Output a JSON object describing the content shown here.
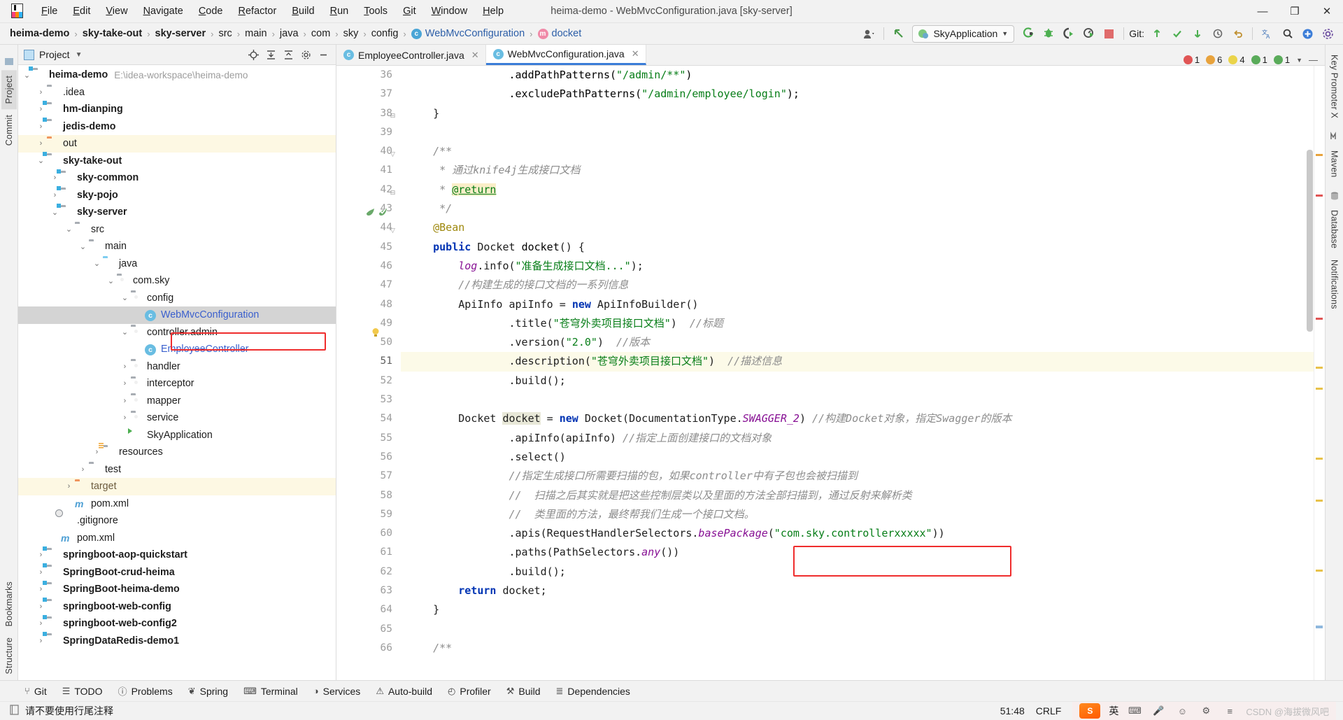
{
  "window": {
    "title": "heima-demo - WebMvcConfiguration.java [sky-server]",
    "minimize": "—",
    "maximize": "❐",
    "close": "✕"
  },
  "menu": [
    {
      "label": "File"
    },
    {
      "label": "Edit"
    },
    {
      "label": "View"
    },
    {
      "label": "Navigate"
    },
    {
      "label": "Code"
    },
    {
      "label": "Refactor"
    },
    {
      "label": "Build"
    },
    {
      "label": "Run"
    },
    {
      "label": "Tools"
    },
    {
      "label": "Git"
    },
    {
      "label": "Window"
    },
    {
      "label": "Help"
    }
  ],
  "breadcrumb": [
    {
      "label": "heima-demo",
      "style": "bold"
    },
    {
      "label": "sky-take-out",
      "style": "bold"
    },
    {
      "label": "sky-server",
      "style": "bold"
    },
    {
      "label": "src",
      "style": "plain"
    },
    {
      "label": "main",
      "style": "plain"
    },
    {
      "label": "java",
      "style": "plain"
    },
    {
      "label": "com",
      "style": "plain"
    },
    {
      "label": "sky",
      "style": "plain"
    },
    {
      "label": "config",
      "style": "plain"
    },
    {
      "label": "WebMvcConfiguration",
      "style": "link",
      "icon": "c"
    },
    {
      "label": "docket",
      "style": "link",
      "icon": "m"
    }
  ],
  "toolbar": {
    "run_config": "SkyApplication",
    "run_config_icon": "spring-boot-icon",
    "git_label": "Git:",
    "icons": [
      "user-avatar-icon",
      "back-arrow-icon",
      "run-icon",
      "debug-icon",
      "run-with-coverage-icon",
      "profiler-icon",
      "stop-icon",
      "git-update-icon",
      "git-commit-icon",
      "git-push-icon",
      "history-icon",
      "undo-icon",
      "translate-icon",
      "search-icon",
      "plugin-icon",
      "settings-icon"
    ]
  },
  "left_strip": [
    "Project",
    "Commit"
  ],
  "bottom_left_strip": [
    "Bookmarks",
    "Structure"
  ],
  "right_strip": [
    "Key Promoter X",
    "Maven",
    "Database",
    "Notifications"
  ],
  "project_panel": {
    "title": "Project",
    "actions": [
      "locate-icon",
      "expand-all-icon",
      "collapse-all-icon",
      "settings-icon",
      "hide-icon"
    ],
    "tree": [
      {
        "depth": 0,
        "arrow": "⌄",
        "icon": "folder-module",
        "label": "heima-demo",
        "bold": true,
        "path": "E:\\idea-workspace\\heima-demo"
      },
      {
        "depth": 1,
        "arrow": "›",
        "icon": "folder",
        "label": ".idea",
        "bold": false
      },
      {
        "depth": 1,
        "arrow": "›",
        "icon": "folder-module",
        "label": "hm-dianping",
        "bold": true
      },
      {
        "depth": 1,
        "arrow": "›",
        "icon": "folder-module",
        "label": "jedis-demo",
        "bold": true
      },
      {
        "depth": 1,
        "arrow": "›",
        "icon": "folder-orange",
        "label": "out",
        "bold": false,
        "highlight": "yellow"
      },
      {
        "depth": 1,
        "arrow": "⌄",
        "icon": "folder-module",
        "label": "sky-take-out",
        "bold": true
      },
      {
        "depth": 2,
        "arrow": "›",
        "icon": "folder-module",
        "label": "sky-common",
        "bold": true
      },
      {
        "depth": 2,
        "arrow": "›",
        "icon": "folder-module",
        "label": "sky-pojo",
        "bold": true
      },
      {
        "depth": 2,
        "arrow": "⌄",
        "icon": "folder-module",
        "label": "sky-server",
        "bold": true
      },
      {
        "depth": 3,
        "arrow": "⌄",
        "icon": "folder",
        "label": "src",
        "bold": false
      },
      {
        "depth": 4,
        "arrow": "⌄",
        "icon": "folder",
        "label": "main",
        "bold": false
      },
      {
        "depth": 5,
        "arrow": "⌄",
        "icon": "folder-src",
        "label": "java",
        "bold": false
      },
      {
        "depth": 6,
        "arrow": "⌄",
        "icon": "folder-pkg",
        "label": "com.sky",
        "bold": false
      },
      {
        "depth": 7,
        "arrow": "⌄",
        "icon": "folder-pkg",
        "label": "config",
        "bold": false
      },
      {
        "depth": 8,
        "arrow": "",
        "icon": "class",
        "label": "WebMvcConfiguration",
        "link": true,
        "selected": true
      },
      {
        "depth": 7,
        "arrow": "⌄",
        "icon": "folder-pkg",
        "label": "controller.admin",
        "bold": false
      },
      {
        "depth": 8,
        "arrow": "",
        "icon": "class",
        "label": "EmployeeController",
        "link": true
      },
      {
        "depth": 7,
        "arrow": "›",
        "icon": "folder-pkg",
        "label": "handler",
        "bold": false
      },
      {
        "depth": 7,
        "arrow": "›",
        "icon": "folder-pkg",
        "label": "interceptor",
        "bold": false
      },
      {
        "depth": 7,
        "arrow": "›",
        "icon": "folder-pkg",
        "label": "mapper",
        "bold": false
      },
      {
        "depth": 7,
        "arrow": "›",
        "icon": "folder-pkg",
        "label": "service",
        "bold": false
      },
      {
        "depth": 7,
        "arrow": "",
        "icon": "spring-class",
        "label": "SkyApplication"
      },
      {
        "depth": 5,
        "arrow": "›",
        "icon": "folder-res",
        "label": "resources",
        "bold": false
      },
      {
        "depth": 4,
        "arrow": "›",
        "icon": "folder",
        "label": "test",
        "bold": false
      },
      {
        "depth": 3,
        "arrow": "›",
        "icon": "folder-orange",
        "label": "target",
        "bold": false,
        "highlight": "yellow",
        "brown": true
      },
      {
        "depth": 3,
        "arrow": "",
        "icon": "maven",
        "label": "pom.xml"
      },
      {
        "depth": 2,
        "arrow": "",
        "icon": "gitignore",
        "label": ".gitignore"
      },
      {
        "depth": 2,
        "arrow": "",
        "icon": "maven",
        "label": "pom.xml"
      },
      {
        "depth": 1,
        "arrow": "›",
        "icon": "folder-module",
        "label": "springboot-aop-quickstart",
        "bold": true
      },
      {
        "depth": 1,
        "arrow": "›",
        "icon": "folder-module",
        "label": "SpringBoot-crud-heima",
        "bold": true
      },
      {
        "depth": 1,
        "arrow": "›",
        "icon": "folder-module",
        "label": "SpringBoot-heima-demo",
        "bold": true
      },
      {
        "depth": 1,
        "arrow": "›",
        "icon": "folder-module",
        "label": "springboot-web-config",
        "bold": true
      },
      {
        "depth": 1,
        "arrow": "›",
        "icon": "folder-module",
        "label": "springboot-web-config2",
        "bold": true
      },
      {
        "depth": 1,
        "arrow": "›",
        "icon": "folder-module",
        "label": "SpringDataRedis-demo1",
        "bold": true
      }
    ]
  },
  "editor": {
    "tabs": [
      {
        "label": "EmployeeController.java",
        "icon": "c",
        "active": false
      },
      {
        "label": "WebMvcConfiguration.java",
        "icon": "c",
        "active": true
      }
    ],
    "inspections": [
      {
        "type": "error",
        "count": "1"
      },
      {
        "type": "warning",
        "count": "6"
      },
      {
        "type": "weak-warning",
        "count": "4"
      },
      {
        "type": "typo",
        "count": "1"
      },
      {
        "type": "ok",
        "count": "1"
      }
    ],
    "first_line": 36,
    "current_line": 51,
    "lines": [
      {
        "n": 36,
        "html": "                <span class=\"lvar\">.addPathPatterns(</span><span class=\"s\">\"/admin/**\"</span><span class=\"lvar\">)</span>"
      },
      {
        "n": 37,
        "html": "                <span class=\"lvar\">.excludePathPatterns(</span><span class=\"s\">\"/admin/employee/login\"</span><span class=\"lvar\">);</span>"
      },
      {
        "n": 38,
        "html": "    }"
      },
      {
        "n": 39,
        "html": ""
      },
      {
        "n": 40,
        "html": "    <span class=\"cm\">/**</span>"
      },
      {
        "n": 41,
        "html": "     <span class=\"cm\">* 通过knife4j生成接口文档</span>"
      },
      {
        "n": 42,
        "html": "     <span class=\"cm\">* </span><span class=\"doctag\">@return</span>"
      },
      {
        "n": 43,
        "html": "     <span class=\"cm\">*/</span>"
      },
      {
        "n": 44,
        "html": "    <span class=\"an\">@Bean</span>"
      },
      {
        "n": 45,
        "html": "    <span class=\"k\">public</span> Docket <span class=\"mth\">docket</span>() {"
      },
      {
        "n": 46,
        "html": "        <span class=\"fd\">log</span>.info(<span class=\"s\">\"准备生成接口文档...\"</span>);"
      },
      {
        "n": 47,
        "html": "        <span class=\"cm\">//构建生成的接口文档的一系列信息</span>"
      },
      {
        "n": 48,
        "html": "        ApiInfo apiInfo = <span class=\"k\">new</span> ApiInfoBuilder()"
      },
      {
        "n": 49,
        "html": "                .title(<span class=\"s\">\"苍穹外卖项目接口文档\"</span>)  <span class=\"cm\">//标题</span>"
      },
      {
        "n": 50,
        "html": "                .version(<span class=\"s\">\"2.0\"</span>)  <span class=\"cm\">//版本</span>"
      },
      {
        "n": 51,
        "html": "                .description(<span class=\"s\">\"苍穹外卖项目接口文档\"</span>)  <span class=\"cm\">//描述信息</span>"
      },
      {
        "n": 52,
        "html": "                .build();"
      },
      {
        "n": 53,
        "html": ""
      },
      {
        "n": 54,
        "html": "        Docket <span class=\"lvarh\">docket</span> = <span class=\"k\">new</span> Docket(DocumentationType.<span class=\"st\">SWAGGER_2</span>) <span class=\"cm\">//构建Docket对象，指定Swagger的版本</span>"
      },
      {
        "n": 55,
        "html": "                .apiInfo(apiInfo) <span class=\"cm\">//指定上面创建接口的文档对象</span>"
      },
      {
        "n": 56,
        "html": "                .select()"
      },
      {
        "n": 57,
        "html": "                <span class=\"cm\">//指定生成接口所需要扫描的包，如果controller中有子包也会被扫描到</span>"
      },
      {
        "n": 58,
        "html": "                <span class=\"cm\">//  扫描之后其实就是把这些控制层类以及里面的方法全部扫描到，通过反射来解析类</span>"
      },
      {
        "n": 59,
        "html": "                <span class=\"cm\">//  类里面的方法，最终帮我们生成一个接口文档。</span>"
      },
      {
        "n": 60,
        "html": "                .apis(RequestHandlerSelectors.<span class=\"st\">basePackage</span>(<span class=\"s\">\"com.sky.controllerxxxxx\"</span>))"
      },
      {
        "n": 61,
        "html": "                .paths(PathSelectors.<span class=\"st\">any</span>())"
      },
      {
        "n": 62,
        "html": "                .build();"
      },
      {
        "n": 63,
        "html": "        <span class=\"k\">return</span> docket;"
      },
      {
        "n": 64,
        "html": "    }"
      },
      {
        "n": 65,
        "html": ""
      },
      {
        "n": 66,
        "html": "    <span class=\"cm\">/**</span>"
      }
    ]
  },
  "bottom_tools": [
    {
      "label": "Git",
      "icon": "git-branch-icon"
    },
    {
      "label": "TODO",
      "icon": "todo-list-icon"
    },
    {
      "label": "Problems",
      "icon": "problems-icon"
    },
    {
      "label": "Spring",
      "icon": "spring-leaf-icon"
    },
    {
      "label": "Terminal",
      "icon": "terminal-icon"
    },
    {
      "label": "Services",
      "icon": "services-icon"
    },
    {
      "label": "Auto-build",
      "icon": "auto-build-icon"
    },
    {
      "label": "Profiler",
      "icon": "profiler-icon"
    },
    {
      "label": "Build",
      "icon": "build-hammer-icon"
    },
    {
      "label": "Dependencies",
      "icon": "dependencies-icon"
    }
  ],
  "status_bar": {
    "message": "请不要使用行尾注释",
    "message_icon": "info-icon",
    "caret_position": "51:48",
    "line_separator": "CRLF",
    "ime": {
      "logo": "sogou-logo",
      "mode": "英",
      "icons": [
        "keyboard-icon",
        "mic-icon",
        "emoji-icon",
        "tools-icon",
        "menu-icon"
      ]
    },
    "watermark": "CSDN @海拔微风吧"
  },
  "colors": {
    "accent": "#3b7dd8",
    "error": "#e05555",
    "warning": "#e8a33d",
    "highlight_box": "#ef2d2d",
    "selection": "#d4d4d4"
  }
}
